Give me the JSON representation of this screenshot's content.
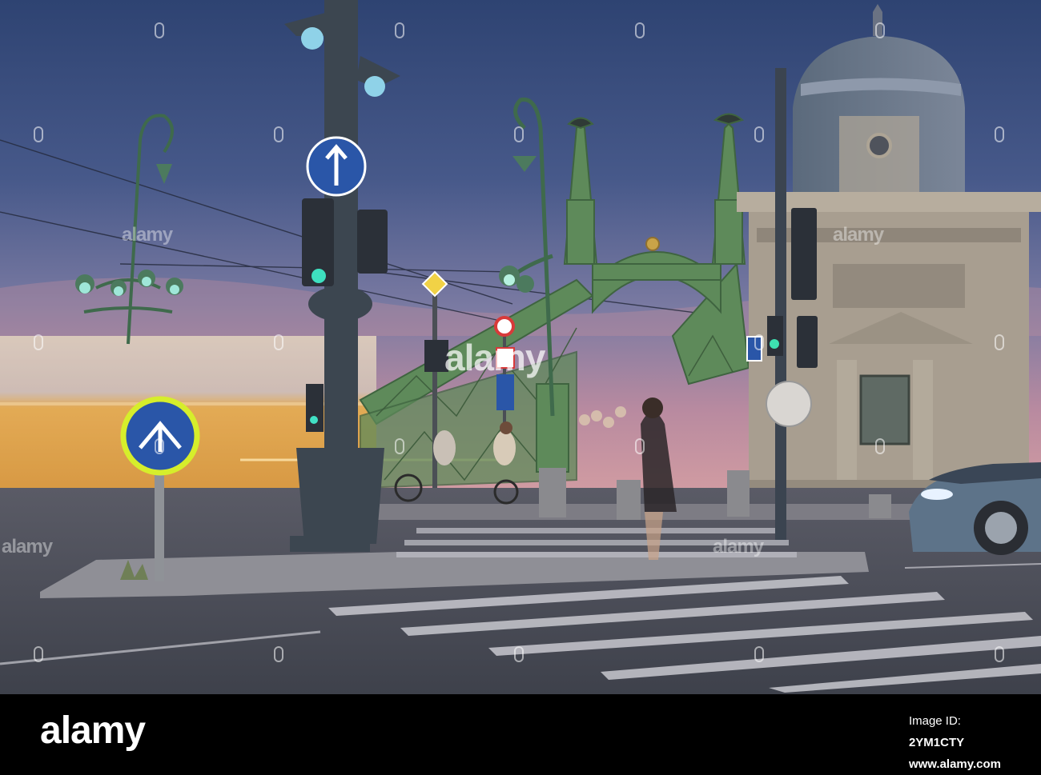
{
  "photo": {
    "description_icon": "photo-scene",
    "colors": {
      "sky_top": "#3b4f78",
      "sky_mid": "#5d6a94",
      "sky_low": "#c48a9a",
      "bridge_green": "#5f8a5c",
      "tram_orange": "#e3a23a",
      "road": "#4b4e58",
      "building": "#a59c8e"
    }
  },
  "watermark": {
    "text": "alamy"
  },
  "footer": {
    "logo": "alamy",
    "image_id_label": "Image ID: ",
    "image_id": "2YM1CTY",
    "site": "www.alamy.com"
  }
}
